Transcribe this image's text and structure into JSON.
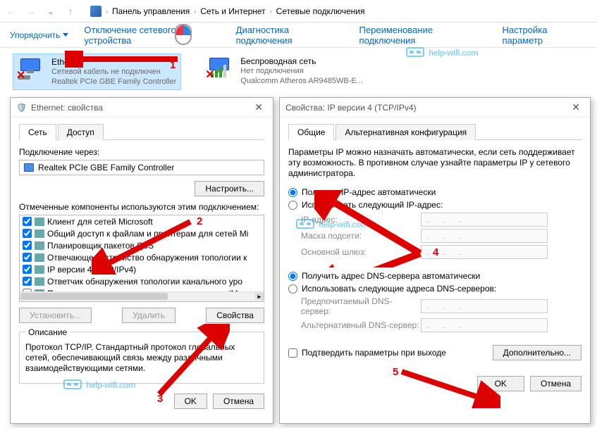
{
  "nav": {
    "crumb1": "Панель управления",
    "crumb2": "Сеть и Интернет",
    "crumb3": "Сетевые подключения"
  },
  "toolbar": {
    "organize": "Упорядочить",
    "disable": "Отключение сетевого устройства",
    "diag": "Диагностика подключения",
    "rename": "Переименование подключения",
    "settings": "Настройка параметр"
  },
  "connections": {
    "eth": {
      "name": "Ethernet",
      "status": "Сетевой кабель не подключен",
      "adapter": "Realtek PCIe GBE Family Controller"
    },
    "wifi": {
      "name": "Беспроводная сеть",
      "status": "Нет подключения",
      "adapter": "Qualcomm Atheros AR9485WB-E..."
    }
  },
  "ethDialog": {
    "title": "Ethernet: свойства",
    "tabs": {
      "net": "Сеть",
      "access": "Доступ"
    },
    "connect_via": "Подключение через:",
    "adapter": "Realtek PCIe GBE Family Controller",
    "configure": "Настроить...",
    "components_label": "Отмеченные компоненты используются этим подключением:",
    "items": [
      "Клиент для сетей Microsoft",
      "Общий доступ к файлам и принтерам для сетей Mi",
      "Планировщик пакетов QoS",
      "Отвечающее устройство обнаружения топологии к",
      "IP версии 4 (TCP/IPv4)",
      "Ответчик обнаружения топологии канального уро",
      "Протокол мультиплексора сетевого адаптера (Ma"
    ],
    "install": "Установить...",
    "uninstall": "Удалить",
    "properties": "Свойства",
    "desc_title": "Описание",
    "desc_text": "Протокол TCP/IP. Стандартный протокол глобальных сетей, обеспечивающий связь между различными взаимодействующими сетями.",
    "ok": "OK",
    "cancel": "Отмена"
  },
  "ipDialog": {
    "title": "Свойства: IP версии 4 (TCP/IPv4)",
    "tabs": {
      "general": "Общие",
      "alt": "Альтернативная конфигурация"
    },
    "intro": "Параметры IP можно назначать автоматически, если сеть поддерживает эту возможность. В противном случае узнайте параметры IP у сетевого администратора.",
    "auto_ip": "Получить IP-адрес автоматически",
    "manual_ip": "Использовать следующий IP-адрес:",
    "ip_addr": "IP-адрес:",
    "mask": "Маска подсети:",
    "gateway": "Основной шлюз:",
    "auto_dns": "Получить адрес DNS-сервера автоматически",
    "manual_dns": "Использовать следующие адреса DNS-серверов:",
    "dns1": "Предпочитаемый DNS-сервер:",
    "dns2": "Альтернативный DNS-сервер:",
    "confirm_exit": "Подтвердить параметры при выходе",
    "advanced": "Дополнительно...",
    "ok": "OK",
    "cancel": "Отмена"
  },
  "watermark": "help-wifi.com",
  "callouts": {
    "n1": "1",
    "n2": "2",
    "n3": "3",
    "n4": "4",
    "n5": "5"
  }
}
